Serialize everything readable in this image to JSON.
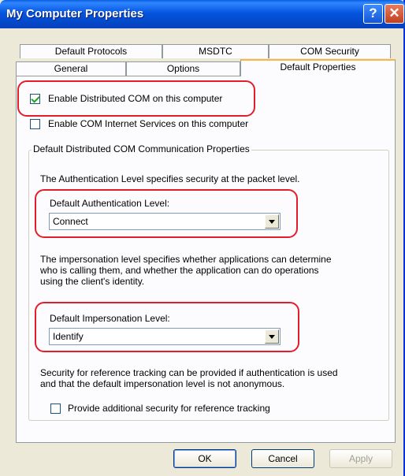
{
  "window": {
    "title": "My Computer Properties"
  },
  "tabs_row1": [
    "Default Protocols",
    "MSDTC",
    "COM Security"
  ],
  "tabs_row2": [
    "General",
    "Options",
    "Default Properties"
  ],
  "checkboxes": {
    "enable_dcom": {
      "label": "Enable Distributed COM on this computer",
      "checked": true
    },
    "enable_internet": {
      "label": "Enable COM Internet Services on this computer",
      "checked": false
    },
    "additional_security": {
      "label": "Provide additional security for reference tracking",
      "checked": false
    }
  },
  "group": {
    "title": "Default Distributed COM Communication Properties",
    "auth_desc": "The Authentication Level specifies security at the packet level.",
    "auth_label": "Default Authentication Level:",
    "auth_value": "Connect",
    "imp_desc_1": "The impersonation level specifies whether applications can determine",
    "imp_desc_2": "who is calling them, and whether the application can do operations",
    "imp_desc_3": "using the client's identity.",
    "imp_label": "Default Impersonation Level:",
    "imp_value": "Identify",
    "ref_desc_1": "Security for reference tracking can be provided if authentication is used",
    "ref_desc_2": "and that the default impersonation level is not anonymous."
  },
  "buttons": {
    "ok": "OK",
    "cancel": "Cancel",
    "apply": "Apply"
  }
}
